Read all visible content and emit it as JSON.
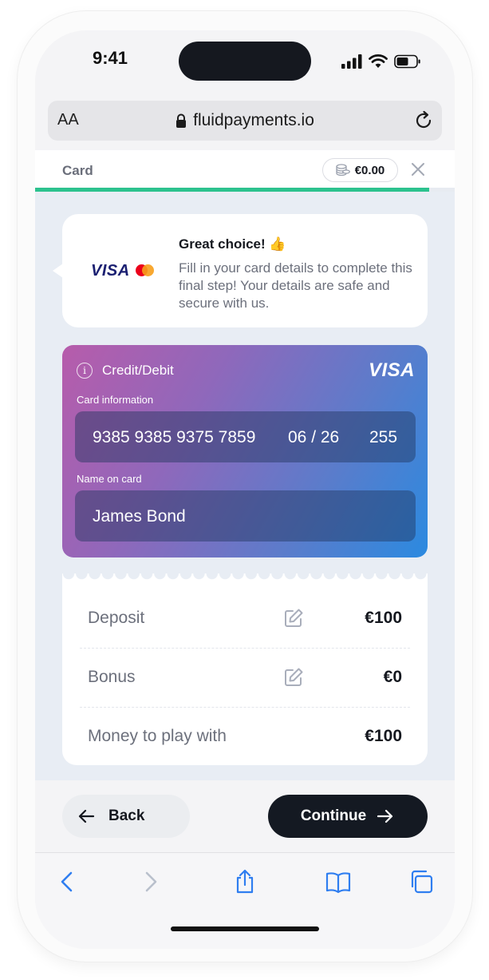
{
  "status_bar": {
    "time": "9:41"
  },
  "browser": {
    "text_size_label": "AA",
    "url": "fluidpayments.io"
  },
  "header": {
    "title": "Card",
    "balance": "€0.00",
    "progress": 0.94
  },
  "info_bubble": {
    "title": "Great choice! 👍",
    "text": "Fill in your card details to complete this final step! Your details are safe and secure with us.",
    "brand_logo": "VISA"
  },
  "card": {
    "type_label": "Credit/Debit",
    "brand": "VISA",
    "info_label": "Card information",
    "number": "9385 9385 9375 7859",
    "expiry": "06 / 26",
    "cvv": "255",
    "name_label": "Name on card",
    "name": "James Bond"
  },
  "summary": [
    {
      "label": "Deposit",
      "value": "€100",
      "editable": true
    },
    {
      "label": "Bonus",
      "value": "€0",
      "editable": true
    },
    {
      "label": "Money to play with",
      "value": "€100",
      "editable": false
    }
  ],
  "actions": {
    "back_label": "Back",
    "continue_label": "Continue"
  },
  "colors": {
    "accent": "#2cc28e",
    "primary_button": "#141922",
    "link_blue": "#2f7ef0"
  },
  "toolbar_icons": [
    "back-icon",
    "forward-icon",
    "share-icon",
    "bookmarks-icon",
    "tabs-icon"
  ]
}
